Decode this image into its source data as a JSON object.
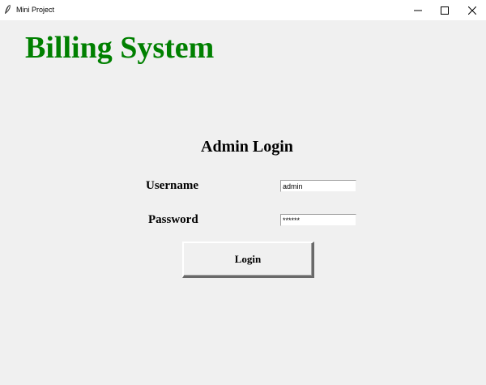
{
  "window": {
    "title": "Mini Project",
    "icon": "feather-icon",
    "controls": {
      "minimize_icon": "minimize-icon",
      "maximize_icon": "maximize-icon",
      "close_icon": "close-icon"
    }
  },
  "app": {
    "title": "Billing System",
    "title_color": "#008000",
    "background": "#f0f0f0"
  },
  "login": {
    "heading": "Admin Login",
    "username_label": "Username",
    "username_value": "admin",
    "password_label": "Password",
    "password_masked": "******",
    "button_label": "Login"
  }
}
